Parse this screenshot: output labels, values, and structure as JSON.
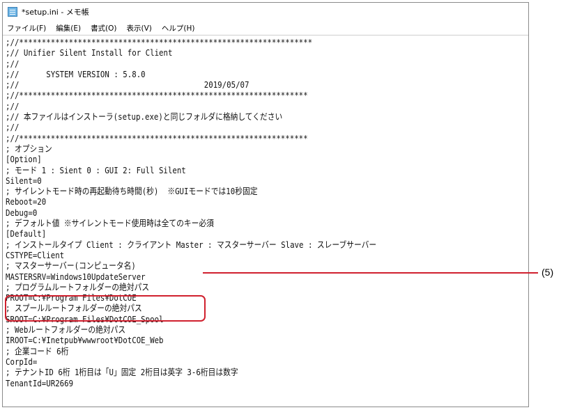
{
  "window": {
    "title": "*setup.ini - メモ帳",
    "icon": "notepad-icon"
  },
  "menu": [
    "ファイル(F)",
    "編集(E)",
    "書式(O)",
    "表示(V)",
    "ヘルプ(H)"
  ],
  "lines": [
    ";//*****************************************************************",
    ";// Unifier Silent Install for Client",
    ";//",
    ";//      SYSTEM VERSION : 5.8.0",
    ";//                                         2019/05/07",
    ";//****************************************************************",
    ";//",
    ";// 本ファイルはインストーラ(setup.exe)と同じフォルダに格納してください",
    ";//",
    ";//****************************************************************",
    "; オプション",
    "[Option]",
    "; モード 1 : Sient 0 : GUI 2: Full Silent",
    "Silent=0",
    "; サイレントモード時の再起動待ち時間(秒)  ※GUIモードでは10秒固定",
    "Reboot=20",
    "Debug=0",
    "; デフォルト値 ※サイレントモード使用時は全てのキー必須",
    "[Default]",
    "; インストールタイプ Client : クライアント Master : マスターサーバー Slave : スレーブサーバー",
    "CSTYPE=Client",
    "; マスターサーバー(コンピュータ名)",
    "MASTERSRV=Windows10UpdateServer",
    "; プログラムルートフォルダーの絶対パス",
    "PROOT=C:¥Program Files¥DotCOE",
    "; スプールルートフォルダーの絶対パス",
    "SROOT=C:¥Program Files¥DotCOE_Spool",
    "; Webルートフォルダーの絶対パス",
    "IROOT=C:¥Inetpub¥wwwroot¥DotCOE_Web",
    "; 企業コード 6桁",
    "CorpId=",
    "; テナントID 6桁 1桁目は「U」固定 2桁目は英字 3-6桁目は数字",
    "TenantId=UR2669"
  ],
  "callout": {
    "label": "(5)",
    "color": "#d0202e"
  }
}
